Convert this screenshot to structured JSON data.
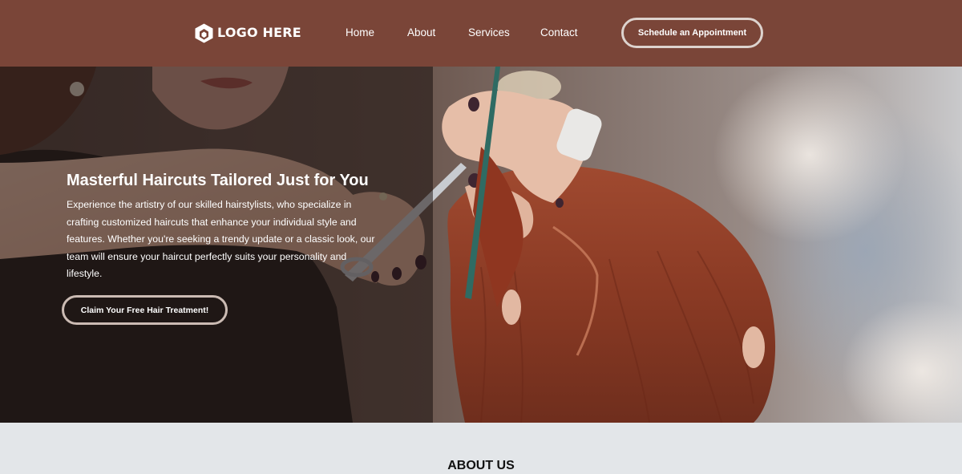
{
  "header": {
    "logo_text": "LOGO HERE",
    "logo_icon": "hexagon-logo-icon",
    "nav": {
      "home": "Home",
      "about": "About",
      "services": "Services",
      "contact": "Contact"
    },
    "cta_label": "Schedule an Appointment"
  },
  "hero": {
    "title": "Masterful Haircuts Tailored Just for You",
    "description": "Experience the artistry of our skilled hairstylists, who specialize in crafting customized haircuts that enhance your individual style and features. Whether you're seeking a trendy update or a classic look, our team will ensure your haircut perfectly suits your personality and lifestyle.",
    "cta_label": "Claim Your Free Hair Treatment!"
  },
  "about": {
    "heading": "ABOUT US"
  },
  "colors": {
    "header_bg": "#7a4538",
    "page_bg": "#e3e6e9",
    "button_border": "#ddd3ce",
    "hair": "#8e3a24"
  }
}
